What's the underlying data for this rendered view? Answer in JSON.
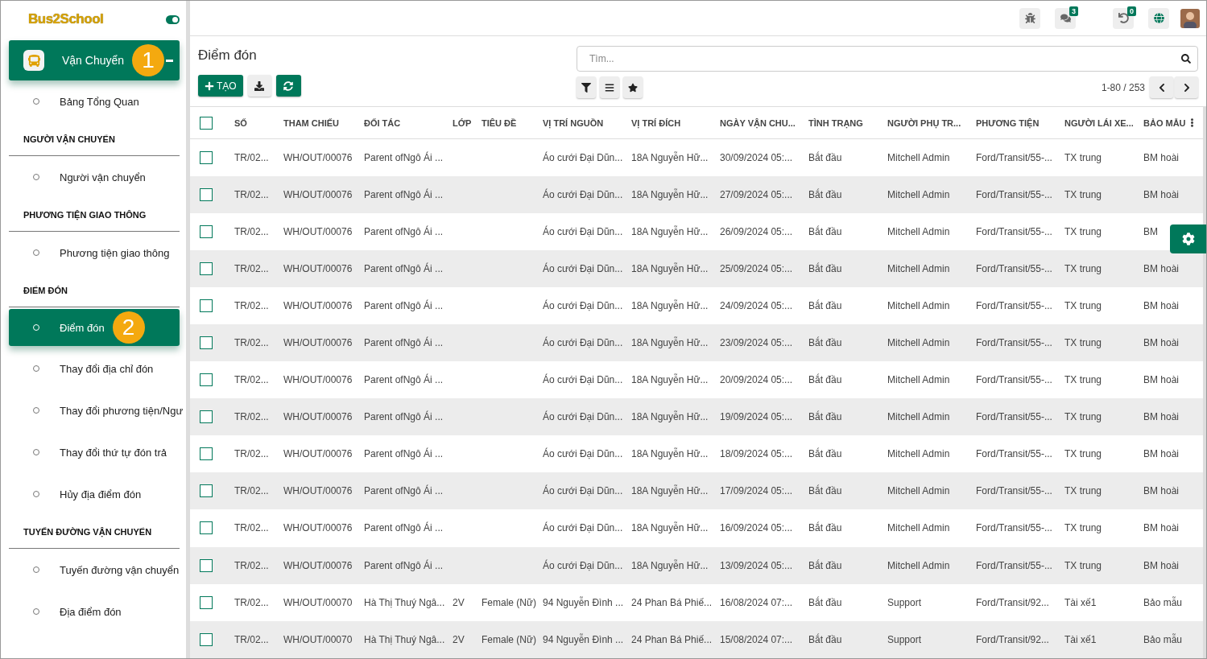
{
  "sidebar": {
    "logo": "Bus2School",
    "toggle": {
      "on": true
    },
    "module": {
      "label": "Vận Chuyển",
      "badge": "1",
      "expanded": true
    },
    "menu": [
      {
        "kind": "link",
        "label": "Bảng Tổng Quan",
        "selected": false
      },
      {
        "kind": "heading",
        "label": "NGƯỜI VẬN CHUYỂN"
      },
      {
        "kind": "link",
        "label": "Người vận chuyển",
        "selected": false
      },
      {
        "kind": "heading",
        "label": "PHƯƠNG TIỆN GIAO THÔNG"
      },
      {
        "kind": "link",
        "label": "Phương tiện giao thông",
        "selected": false
      },
      {
        "kind": "heading",
        "label": "ĐIỂM ĐÓN"
      },
      {
        "kind": "link",
        "label": "Điểm đón",
        "selected": true,
        "badge": "2"
      },
      {
        "kind": "link",
        "label": "Thay đổi địa chỉ đón",
        "selected": false
      },
      {
        "kind": "link",
        "label": "Thay đổi phương tiện/Ngư",
        "selected": false
      },
      {
        "kind": "link",
        "label": "Thay đổi thứ tự đón trả",
        "selected": false
      },
      {
        "kind": "link",
        "label": "Hủy địa điểm đón",
        "selected": false
      },
      {
        "kind": "heading",
        "label": "TUYẾN ĐƯỜNG VẬN CHUYỂN"
      },
      {
        "kind": "link",
        "label": "Tuyến đường vận chuyển",
        "selected": false
      },
      {
        "kind": "link",
        "label": "Địa điểm đón",
        "selected": false
      }
    ]
  },
  "topbar": {
    "messages_count": "3",
    "activity_count": "0"
  },
  "page": {
    "title": "Điểm đón",
    "search": {
      "placeholder": "Tìm..."
    },
    "create_button": "TẠO",
    "pager": "1-80 / 253"
  },
  "table": {
    "all_selected": false,
    "columns": [
      "SỐ",
      "THAM CHIẾU",
      "ĐỐI TÁC",
      "LỚP",
      "TIÊU ĐỀ",
      "VỊ TRÍ NGUỒN",
      "VỊ TRÍ ĐÍCH",
      "NGÀY VẬN CHU...",
      "TÌNH TRẠNG",
      "NGƯỜI PHỤ TR...",
      "PHƯƠNG TIỆN",
      "NGƯỜI LÁI XE...",
      "BẢO MẪU"
    ],
    "rows": [
      {
        "selected": false,
        "cells": [
          "TR/02...",
          "WH/OUT/00076",
          "Parent ofNgô Ái ...",
          "",
          "",
          "Áo cưới Đại Dũn...",
          "18A Nguyễn Hữ...",
          "30/09/2024 05:...",
          "Bắt đầu",
          "Mitchell Admin",
          "Ford/Transit/55-...",
          "TX trung",
          "BM hoài"
        ]
      },
      {
        "selected": false,
        "cells": [
          "TR/02...",
          "WH/OUT/00076",
          "Parent ofNgô Ái ...",
          "",
          "",
          "Áo cưới Đại Dũn...",
          "18A Nguyễn Hữ...",
          "27/09/2024 05:...",
          "Bắt đầu",
          "Mitchell Admin",
          "Ford/Transit/55-...",
          "TX trung",
          "BM hoài"
        ]
      },
      {
        "selected": false,
        "cells": [
          "TR/02...",
          "WH/OUT/00076",
          "Parent ofNgô Ái ...",
          "",
          "",
          "Áo cưới Đại Dũn...",
          "18A Nguyễn Hữ...",
          "26/09/2024 05:...",
          "Bắt đầu",
          "Mitchell Admin",
          "Ford/Transit/55-...",
          "TX trung",
          "BM"
        ]
      },
      {
        "selected": false,
        "cells": [
          "TR/02...",
          "WH/OUT/00076",
          "Parent ofNgô Ái ...",
          "",
          "",
          "Áo cưới Đại Dũn...",
          "18A Nguyễn Hữ...",
          "25/09/2024 05:...",
          "Bắt đầu",
          "Mitchell Admin",
          "Ford/Transit/55-...",
          "TX trung",
          "BM hoài"
        ]
      },
      {
        "selected": false,
        "cells": [
          "TR/02...",
          "WH/OUT/00076",
          "Parent ofNgô Ái ...",
          "",
          "",
          "Áo cưới Đại Dũn...",
          "18A Nguyễn Hữ...",
          "24/09/2024 05:...",
          "Bắt đầu",
          "Mitchell Admin",
          "Ford/Transit/55-...",
          "TX trung",
          "BM hoài"
        ]
      },
      {
        "selected": false,
        "cells": [
          "TR/02...",
          "WH/OUT/00076",
          "Parent ofNgô Ái ...",
          "",
          "",
          "Áo cưới Đại Dũn...",
          "18A Nguyễn Hữ...",
          "23/09/2024 05:...",
          "Bắt đầu",
          "Mitchell Admin",
          "Ford/Transit/55-...",
          "TX trung",
          "BM hoài"
        ]
      },
      {
        "selected": false,
        "cells": [
          "TR/02...",
          "WH/OUT/00076",
          "Parent ofNgô Ái ...",
          "",
          "",
          "Áo cưới Đại Dũn...",
          "18A Nguyễn Hữ...",
          "20/09/2024 05:...",
          "Bắt đầu",
          "Mitchell Admin",
          "Ford/Transit/55-...",
          "TX trung",
          "BM hoài"
        ]
      },
      {
        "selected": false,
        "cells": [
          "TR/02...",
          "WH/OUT/00076",
          "Parent ofNgô Ái ...",
          "",
          "",
          "Áo cưới Đại Dũn...",
          "18A Nguyễn Hữ...",
          "19/09/2024 05:...",
          "Bắt đầu",
          "Mitchell Admin",
          "Ford/Transit/55-...",
          "TX trung",
          "BM hoài"
        ]
      },
      {
        "selected": false,
        "cells": [
          "TR/02...",
          "WH/OUT/00076",
          "Parent ofNgô Ái ...",
          "",
          "",
          "Áo cưới Đại Dũn...",
          "18A Nguyễn Hữ...",
          "18/09/2024 05:...",
          "Bắt đầu",
          "Mitchell Admin",
          "Ford/Transit/55-...",
          "TX trung",
          "BM hoài"
        ]
      },
      {
        "selected": false,
        "cells": [
          "TR/02...",
          "WH/OUT/00076",
          "Parent ofNgô Ái ...",
          "",
          "",
          "Áo cưới Đại Dũn...",
          "18A Nguyễn Hữ...",
          "17/09/2024 05:...",
          "Bắt đầu",
          "Mitchell Admin",
          "Ford/Transit/55-...",
          "TX trung",
          "BM hoài"
        ]
      },
      {
        "selected": false,
        "cells": [
          "TR/02...",
          "WH/OUT/00076",
          "Parent ofNgô Ái ...",
          "",
          "",
          "Áo cưới Đại Dũn...",
          "18A Nguyễn Hữ...",
          "16/09/2024 05:...",
          "Bắt đầu",
          "Mitchell Admin",
          "Ford/Transit/55-...",
          "TX trung",
          "BM hoài"
        ]
      },
      {
        "selected": false,
        "cells": [
          "TR/02...",
          "WH/OUT/00076",
          "Parent ofNgô Ái ...",
          "",
          "",
          "Áo cưới Đại Dũn...",
          "18A Nguyễn Hữ...",
          "13/09/2024 05:...",
          "Bắt đầu",
          "Mitchell Admin",
          "Ford/Transit/55-...",
          "TX trung",
          "BM hoài"
        ]
      },
      {
        "selected": false,
        "cells": [
          "TR/02...",
          "WH/OUT/00070",
          "Hà Thị Thuý Ngâ...",
          "2V",
          "Female (Nữ)",
          "94 Nguyễn Đình ...",
          "24 Phan Bá Phiế...",
          "16/08/2024 07:...",
          "Bắt đầu",
          "Support",
          "Ford/Transit/92...",
          "Tài xế1",
          "Bảo mẫu"
        ]
      },
      {
        "selected": false,
        "cells": [
          "TR/02...",
          "WH/OUT/00070",
          "Hà Thị Thuý Ngâ...",
          "2V",
          "Female (Nữ)",
          "94 Nguyễn Đình ...",
          "24 Phan Bá Phiế...",
          "15/08/2024 07:...",
          "Bắt đầu",
          "Support",
          "Ford/Transit/92...",
          "Tài xế1",
          "Bảo mẫu"
        ]
      }
    ]
  }
}
